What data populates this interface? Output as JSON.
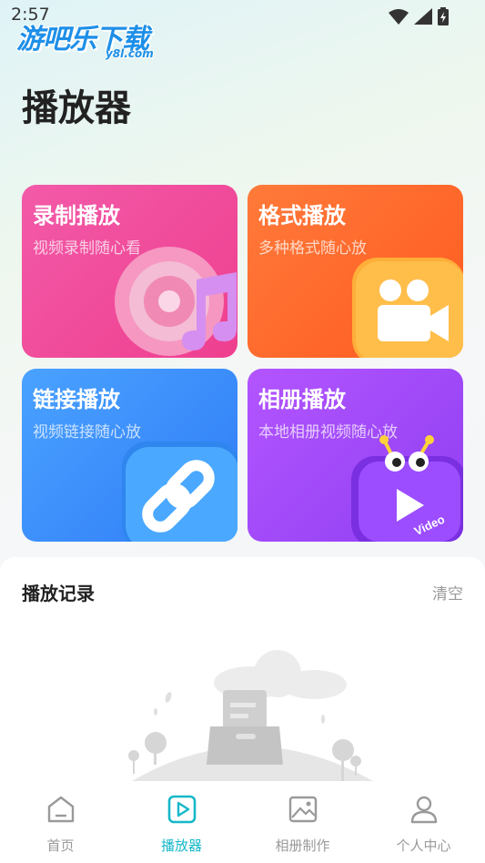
{
  "status_bar": {
    "time": "2:57",
    "icons": [
      "wifi-icon",
      "signal-icon",
      "battery-icon"
    ]
  },
  "watermark": {
    "main": "游吧乐下载",
    "sub": "y8l.com"
  },
  "page_title": "播放器",
  "cards": [
    {
      "title": "录制播放",
      "subtitle": "视频录制随心看",
      "icon": "music-disc-icon",
      "color": "#f04a98"
    },
    {
      "title": "格式播放",
      "subtitle": "多种格式随心放",
      "icon": "video-camera-icon",
      "color": "#ff6a2a"
    },
    {
      "title": "链接播放",
      "subtitle": "视频链接随心放",
      "icon": "link-icon",
      "color": "#3e92fb"
    },
    {
      "title": "相册播放",
      "subtitle": "本地相册视频随心放",
      "icon": "tv-video-icon",
      "badge": "Video",
      "color": "#a24bfa"
    }
  ],
  "history": {
    "title": "播放记录",
    "clear_label": "清空",
    "empty_icon": "empty-inbox-icon"
  },
  "tabbar": {
    "accent": "#16b8c9",
    "items": [
      {
        "label": "首页",
        "icon": "home-icon",
        "active": false
      },
      {
        "label": "播放器",
        "icon": "play-icon",
        "active": true
      },
      {
        "label": "相册制作",
        "icon": "image-icon",
        "active": false
      },
      {
        "label": "个人中心",
        "icon": "user-icon",
        "active": false
      }
    ]
  }
}
